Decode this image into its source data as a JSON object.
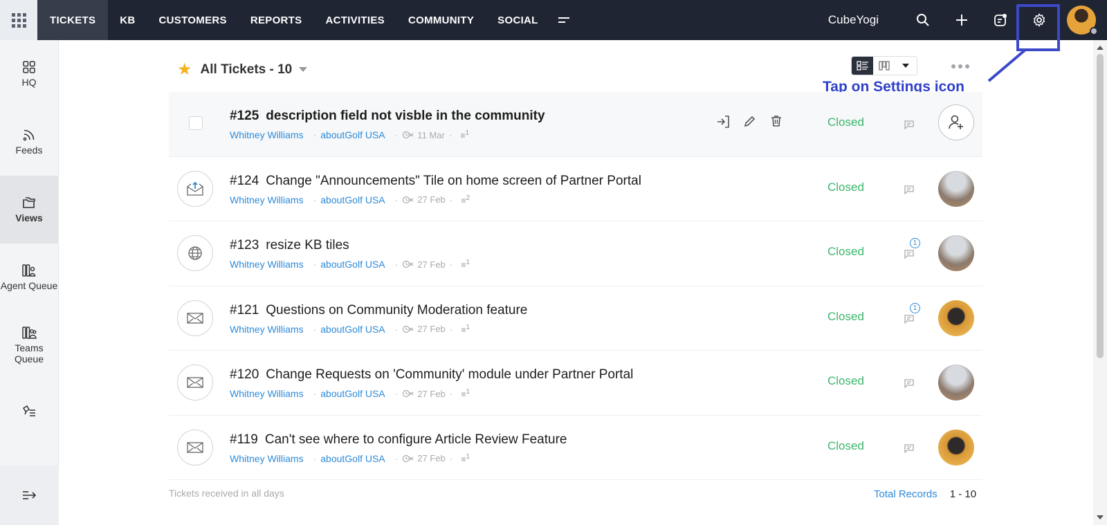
{
  "topbar": {
    "nav": [
      "TICKETS",
      "KB",
      "CUSTOMERS",
      "REPORTS",
      "ACTIVITIES",
      "COMMUNITY",
      "SOCIAL"
    ],
    "active_tab": "TICKETS",
    "org_name": "CubeYogi"
  },
  "sidebar": {
    "items": [
      {
        "label": "HQ",
        "icon": "grid-icon"
      },
      {
        "label": "Feeds",
        "icon": "feeds-icon"
      },
      {
        "label": "Views",
        "icon": "views-icon",
        "active": true
      },
      {
        "label": "Agent Queue",
        "icon": "agent-queue-icon"
      },
      {
        "label": "Teams Queue",
        "icon": "teams-queue-icon"
      },
      {
        "label": "",
        "icon": "tag-list-icon"
      }
    ]
  },
  "header": {
    "view_title": "All Tickets - 10"
  },
  "annotation": {
    "text": "Tap on Settings icon"
  },
  "tickets": [
    {
      "id": "#125",
      "title": "description field not visble in the community",
      "contact": "Whitney Williams",
      "account": "aboutGolf USA",
      "date": "11 Mar",
      "threads": "1",
      "status": "Closed",
      "comments": "",
      "channel": "checkbox",
      "assignee": "unassigned"
    },
    {
      "id": "#124",
      "title": "Change \"Announcements\" Tile on home screen of Partner Portal",
      "contact": "Whitney Williams",
      "account": "aboutGolf USA",
      "date": "27 Feb",
      "threads": "2",
      "status": "Closed",
      "comments": "",
      "channel": "email-out-icon",
      "assignee": "sea"
    },
    {
      "id": "#123",
      "title": "resize KB tiles",
      "contact": "Whitney Williams",
      "account": "aboutGolf USA",
      "date": "27 Feb",
      "threads": "1",
      "status": "Closed",
      "comments": "1",
      "channel": "web-icon",
      "assignee": "sea"
    },
    {
      "id": "#121",
      "title": "Questions on Community Moderation feature",
      "contact": "Whitney Williams",
      "account": "aboutGolf USA",
      "date": "27 Feb",
      "threads": "1",
      "status": "Closed",
      "comments": "1",
      "channel": "email-icon",
      "assignee": "warm"
    },
    {
      "id": "#120",
      "title": "Change Requests on 'Community' module under Partner Portal",
      "contact": "Whitney Williams",
      "account": "aboutGolf USA",
      "date": "27 Feb",
      "threads": "1",
      "status": "Closed",
      "comments": "",
      "channel": "email-icon",
      "assignee": "sea"
    },
    {
      "id": "#119",
      "title": "Can't see where to configure Article Review Feature",
      "contact": "Whitney Williams",
      "account": "aboutGolf USA",
      "date": "27 Feb",
      "threads": "1",
      "status": "Closed",
      "comments": "",
      "channel": "email-icon",
      "assignee": "warm"
    }
  ],
  "footer": {
    "note": "Tickets received in all days",
    "total_label": "Total Records",
    "range": "1 - 10"
  },
  "colors": {
    "topbar": "#1f2532",
    "status_closed": "#3bb56b",
    "link": "#2e8ad8",
    "annotation": "#3c49c8"
  }
}
